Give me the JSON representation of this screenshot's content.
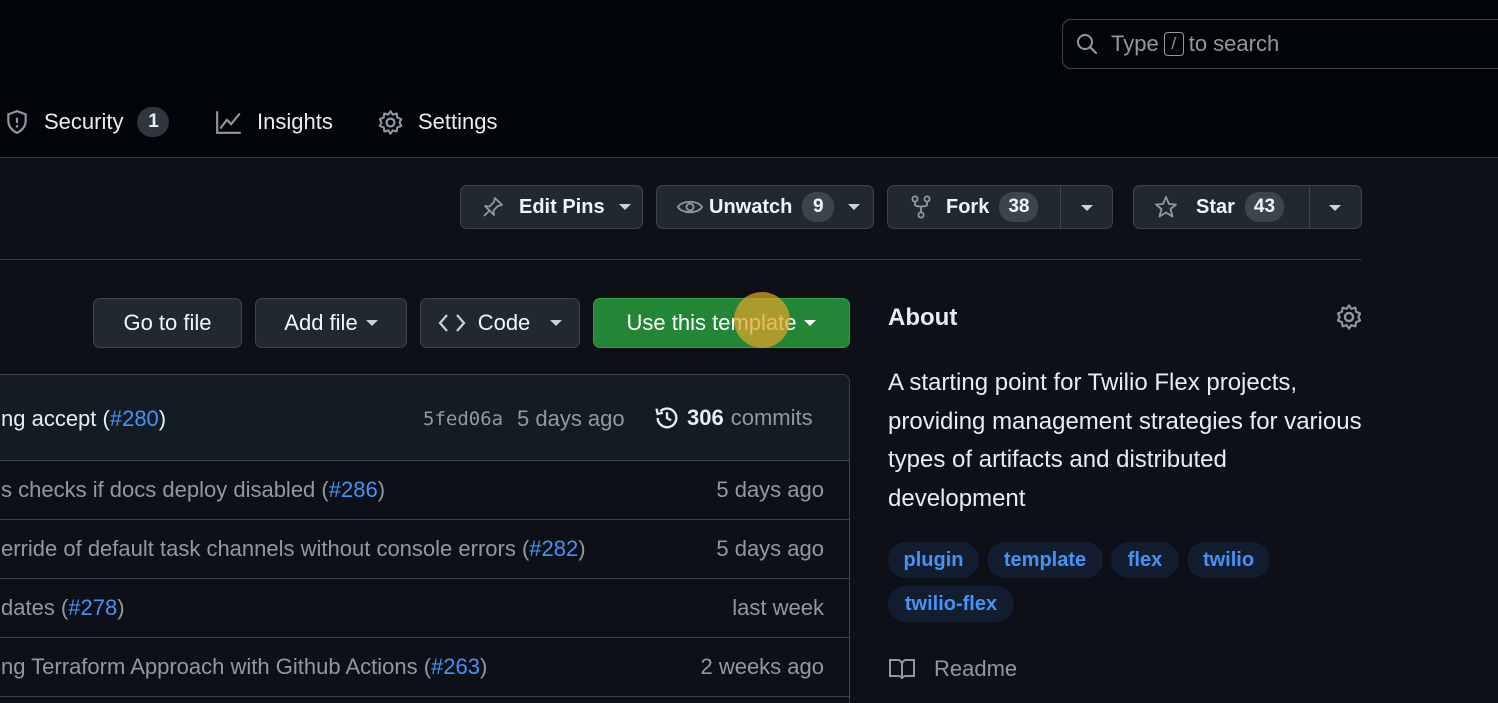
{
  "search": {
    "prefix": "Type",
    "key": "/",
    "suffix": "to search"
  },
  "nav": [
    {
      "label": "Security",
      "count": "1",
      "icon": "shield-icon"
    },
    {
      "label": "Insights",
      "icon": "graph-icon"
    },
    {
      "label": "Settings",
      "icon": "gear-icon"
    }
  ],
  "actions": {
    "edit_pins": "Edit Pins",
    "unwatch": "Unwatch",
    "unwatch_count": "9",
    "fork": "Fork",
    "fork_count": "38",
    "star": "Star",
    "star_count": "43"
  },
  "file_bar": {
    "go_to_file": "Go to file",
    "add_file": "Add file",
    "code": "Code",
    "use_template": "Use this template"
  },
  "latest_commit": {
    "message": "ng accept (",
    "pr": "#280",
    "message_end": ")",
    "sha": "5fed06a",
    "age": "5 days ago",
    "commit_count": "306",
    "commit_label": "commits"
  },
  "commits": [
    {
      "message": "s checks if docs deploy disabled (",
      "pr": "#286",
      "end": ")",
      "age": "5 days ago"
    },
    {
      "message": "erride of default task channels without console errors (",
      "pr": "#282",
      "end": ")",
      "age": "5 days ago"
    },
    {
      "message": "dates (",
      "pr": "#278",
      "end": ")",
      "age": "last week"
    },
    {
      "message": "ng Terraform Approach with Github Actions (",
      "pr": "#263",
      "end": ")",
      "age": "2 weeks ago"
    }
  ],
  "about": {
    "title": "About",
    "description": "A starting point for Twilio Flex projects, providing management strategies for various types of artifacts and distributed development",
    "topics": [
      "plugin",
      "template",
      "flex",
      "twilio",
      "twilio-flex"
    ],
    "readme": "Readme"
  },
  "colors": {
    "accent": "#4493f8",
    "primary_button": "#238636",
    "background": "#0d1117"
  }
}
